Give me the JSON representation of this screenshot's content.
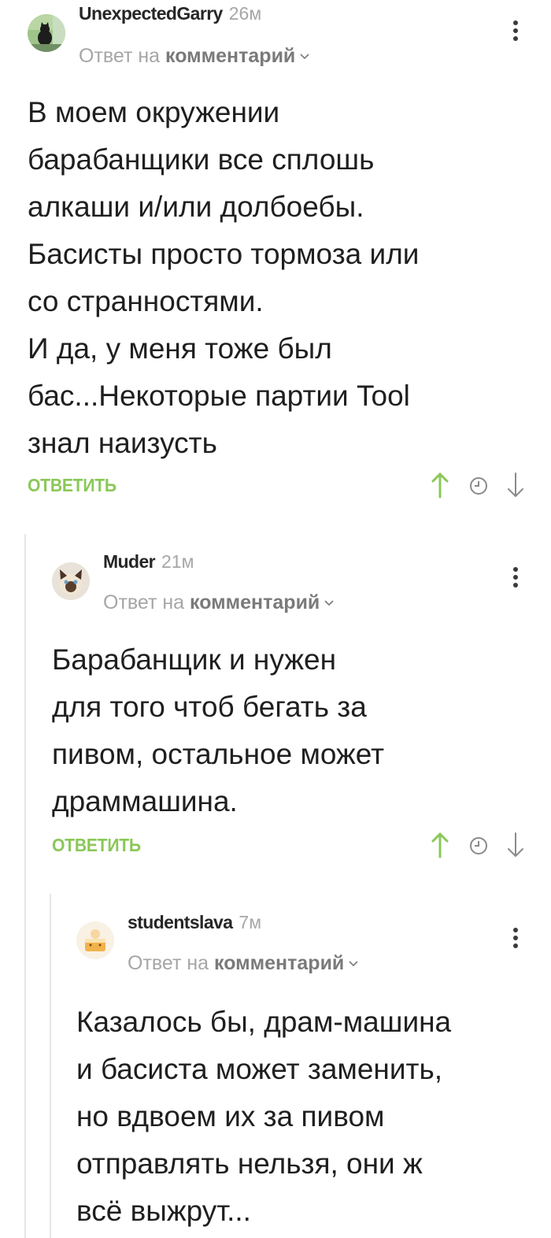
{
  "comments": [
    {
      "author": "UnexpectedGarry",
      "time": "26м",
      "reply_prefix": "Ответ на",
      "reply_link": "комментарий",
      "avatar": "avatar-black-cat-on-grass",
      "lines": [
        "В моем окружении",
        "барабанщики все сплошь",
        "алкаши и/или долбоебы.",
        "Басисты просто тормоза или",
        "со странностями.",
        "И да, у меня тоже был",
        "бас...Некоторые партии Tool",
        "знал наизусть"
      ],
      "reply_button": "ОТВЕТИТЬ"
    },
    {
      "author": "Muder",
      "time": "21м",
      "reply_prefix": "Ответ на",
      "reply_link": "комментарий",
      "avatar": "avatar-siamese-cat",
      "lines": [
        "Барабанщик и нужен",
        "для того чтоб бегать за",
        "пивом, остальное может",
        "драммашина."
      ],
      "reply_button": "ОТВЕТИТЬ"
    },
    {
      "author": "studentslava",
      "time": "7м",
      "reply_prefix": "Ответ на",
      "reply_link": "комментарий",
      "avatar": "avatar-cartoon-cake",
      "lines": [
        "Казалось бы, драм-машина",
        "и басиста может заменить,",
        "но вдвоем их за пивом",
        "отправлять нельзя, они ж",
        "всё выжрут..."
      ]
    }
  ],
  "colors": {
    "accent_green": "#8ac858",
    "muted_text": "#a6a6a6",
    "thread_line": "#e6e6e6"
  },
  "icons": [
    "upvote-icon",
    "save-clock-icon",
    "downvote-icon",
    "more-options-icon",
    "chevron-down-icon"
  ]
}
